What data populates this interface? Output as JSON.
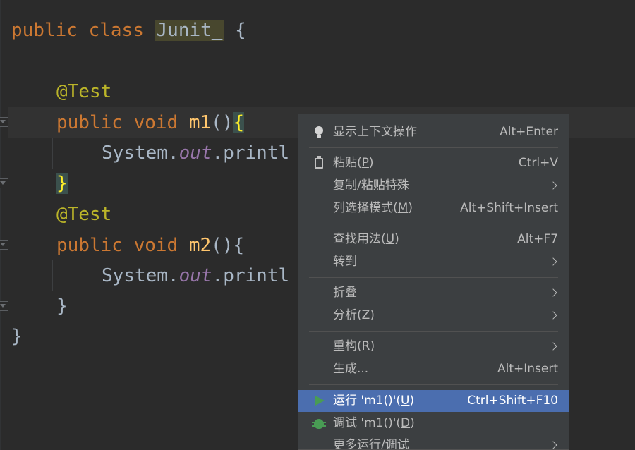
{
  "code": {
    "lines": [
      {
        "kw1": "public",
        "kw2": "class",
        "name": "Junit_",
        "rest": " {"
      },
      {
        "ann": "@Test"
      },
      {
        "kw1": "public",
        "kw2": "void",
        "fn": "m1",
        "parens": "()",
        "brace": "{"
      },
      {
        "cls": "System.",
        "field": "out",
        "call": ".printl"
      },
      {
        "brace": "}"
      },
      {
        "ann": "@Test"
      },
      {
        "kw1": "public",
        "kw2": "void",
        "fn": "m2",
        "parens": "()",
        "brace": "{"
      },
      {
        "cls": "System.",
        "field": "out",
        "call": ".printl"
      },
      {
        "brace": "}"
      },
      {
        "brace": "}"
      }
    ]
  },
  "menu": {
    "items": [
      {
        "label": "显示上下文操作",
        "shortcut": "Alt+Enter",
        "icon": "lightbulb-icon"
      },
      {
        "label_pre": "粘贴(",
        "mnemonic": "P",
        "label_post": ")",
        "shortcut": "Ctrl+V",
        "icon": "clipboard-icon"
      },
      {
        "label": "复制/粘贴特殊",
        "submenu": true
      },
      {
        "label_pre": "列选择模式(",
        "mnemonic": "M",
        "label_post": ")",
        "shortcut": "Alt+Shift+Insert"
      },
      {
        "label_pre": "查找用法(",
        "mnemonic": "U",
        "label_post": ")",
        "shortcut": "Alt+F7"
      },
      {
        "label": "转到",
        "submenu": true
      },
      {
        "label": "折叠",
        "submenu": true
      },
      {
        "label_pre": "分析(",
        "mnemonic": "Z",
        "label_post": ")",
        "submenu": true
      },
      {
        "label_pre": "重构(",
        "mnemonic": "R",
        "label_post": ")",
        "submenu": true
      },
      {
        "label": "生成...",
        "shortcut": "Alt+Insert"
      },
      {
        "label_pre": "运行 'm1()'(",
        "mnemonic": "U",
        "label_post": ")",
        "shortcut": "Ctrl+Shift+F10",
        "icon": "run-icon",
        "selected": true
      },
      {
        "label_pre": "调试 'm1()'(",
        "mnemonic": "D",
        "label_post": ")",
        "icon": "debug-icon"
      },
      {
        "label": "更多运行/调试",
        "submenu": true
      }
    ]
  },
  "colors": {
    "editor_bg": "#2b2b2b",
    "keyword": "#cc7832",
    "annotation": "#bbb529",
    "function": "#ffc66d",
    "field": "#9876aa",
    "menu_bg": "#3c3f41",
    "selection": "#4b6eaf",
    "run_green": "#499c54"
  }
}
